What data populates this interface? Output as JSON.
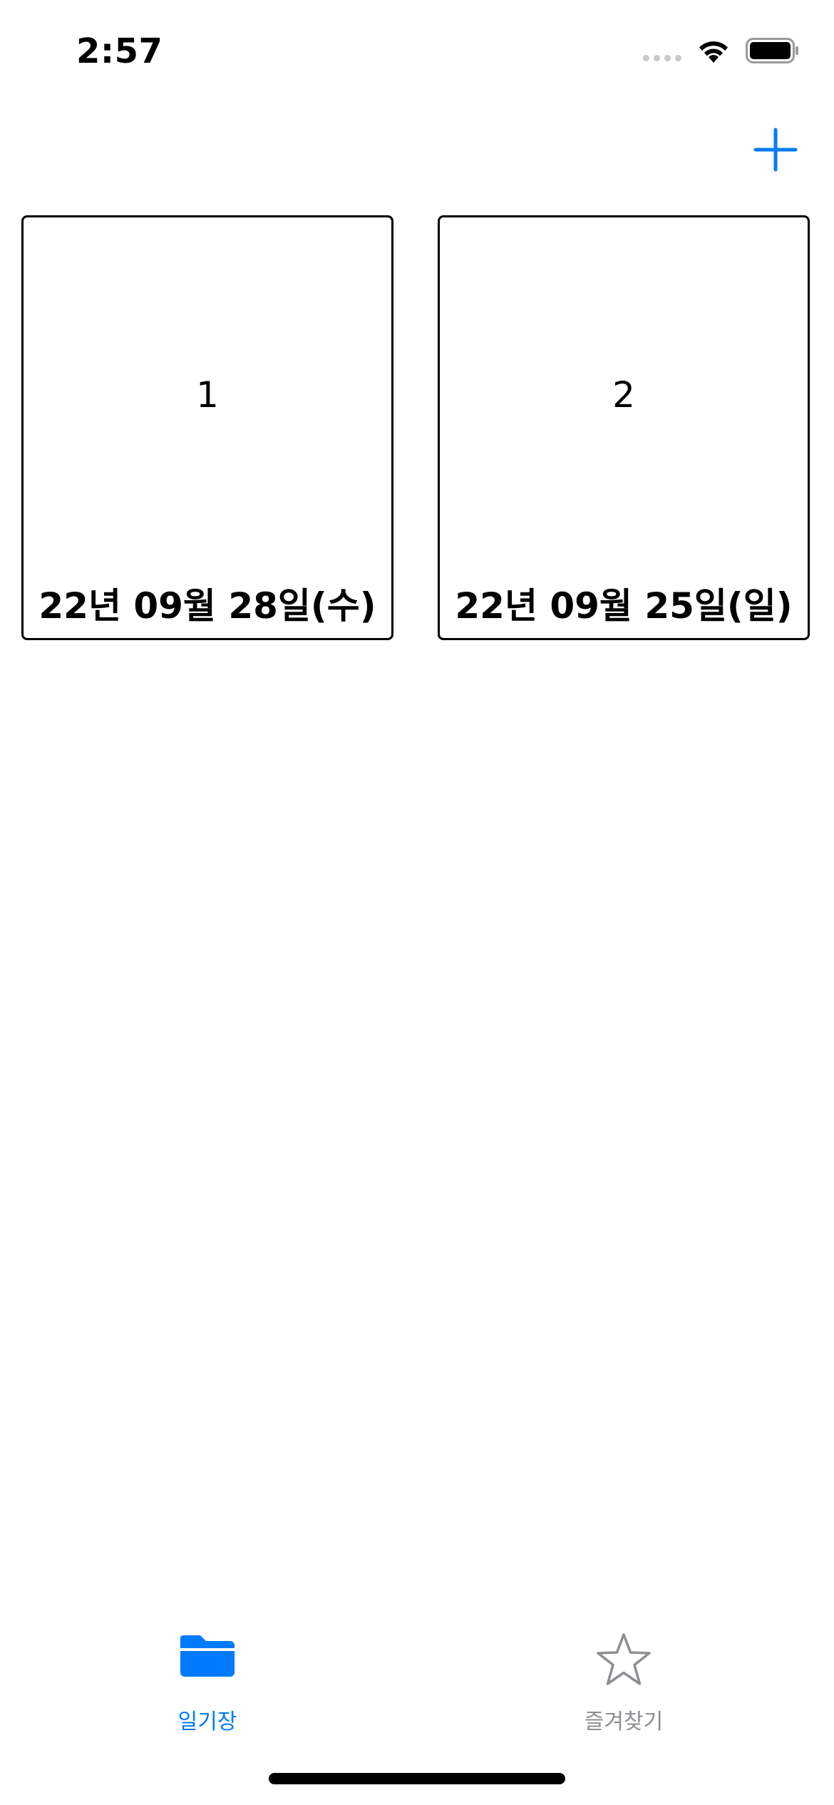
{
  "status_bar": {
    "time": "2:57",
    "wifi_icon": "wifi-icon",
    "battery_icon": "battery-icon",
    "signal_icon": "cellular-signal-icon"
  },
  "nav": {
    "add_icon": "plus-icon",
    "accent_color": "#007aff"
  },
  "cards": [
    {
      "title": "1",
      "date": "22년 09월 28일(수)"
    },
    {
      "title": "2",
      "date": "22년 09월 25일(일)"
    }
  ],
  "tab_bar": {
    "tabs": [
      {
        "label": "일기장",
        "icon": "folder-icon",
        "selected": true,
        "color": "#007aff"
      },
      {
        "label": "즐겨찾기",
        "icon": "star-icon",
        "selected": false,
        "color": "#8e8e93"
      }
    ]
  }
}
